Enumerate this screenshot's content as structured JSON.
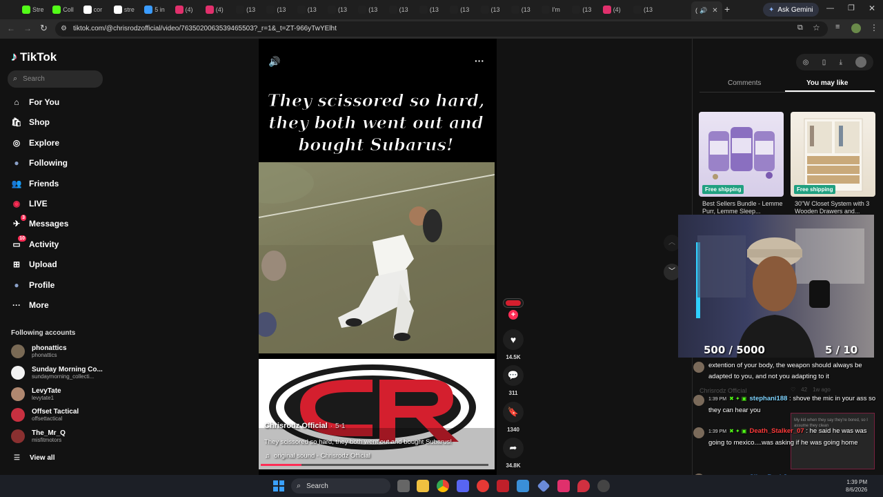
{
  "browser": {
    "tabs": [
      {
        "label": "Stre",
        "color": "#53fc18"
      },
      {
        "label": "Coll",
        "color": "#53fc18"
      },
      {
        "label": "cor",
        "color": "#ffffff"
      },
      {
        "label": "stre",
        "color": "#ffffff"
      },
      {
        "label": "5 in",
        "color": "#3b9cff"
      },
      {
        "label": "(4)",
        "color": "#e1306c"
      },
      {
        "label": "(4)",
        "color": "#e1306c"
      },
      {
        "label": "(13",
        "color": "#222222"
      },
      {
        "label": "(13",
        "color": "#222222"
      },
      {
        "label": "(13",
        "color": "#222222"
      },
      {
        "label": "(13",
        "color": "#222222"
      },
      {
        "label": "(13",
        "color": "#222222"
      },
      {
        "label": "(13",
        "color": "#222222"
      },
      {
        "label": "(13",
        "color": "#222222"
      },
      {
        "label": "(13",
        "color": "#222222"
      },
      {
        "label": "(13",
        "color": "#222222"
      },
      {
        "label": "(13",
        "color": "#222222"
      },
      {
        "label": "I'm",
        "color": "#222222"
      },
      {
        "label": "(13",
        "color": "#222222"
      },
      {
        "label": "(4)",
        "color": "#e1306c"
      },
      {
        "label": "(13",
        "color": "#222222"
      }
    ],
    "active_tab_label": "(",
    "ask_gemini": "Ask Gemini",
    "url": "tiktok.com/@chrisrodzofficial/video/7635020063539465503?_r=1&_t=ZT-966yTwYElht"
  },
  "sidebar": {
    "brand": "TikTok",
    "search_placeholder": "Search",
    "nav": [
      {
        "label": "For You",
        "icon": "home-icon"
      },
      {
        "label": "Shop",
        "icon": "shop-icon"
      },
      {
        "label": "Explore",
        "icon": "compass-icon"
      },
      {
        "label": "Following",
        "icon": "following-icon"
      },
      {
        "label": "Friends",
        "icon": "friends-icon"
      },
      {
        "label": "LIVE",
        "icon": "live-icon"
      },
      {
        "label": "Messages",
        "icon": "messages-icon",
        "badge": "3"
      },
      {
        "label": "Activity",
        "icon": "activity-icon",
        "badge": "10"
      },
      {
        "label": "Upload",
        "icon": "upload-icon"
      },
      {
        "label": "Profile",
        "icon": "profile-icon"
      },
      {
        "label": "More",
        "icon": "more-icon"
      }
    ],
    "following_heading": "Following accounts",
    "accounts": [
      {
        "name": "phonattics",
        "handle": "phonattics",
        "color": "#7a6a55"
      },
      {
        "name": "Sunday Morning Co...",
        "handle": "sundaymorning_collecti...",
        "color": "#f2f2f2"
      },
      {
        "name": "LevyTate",
        "handle": "levytate1",
        "color": "#b08870"
      },
      {
        "name": "Offset Tactical",
        "handle": "offsettactical",
        "color": "#c83040"
      },
      {
        "name": "The_Mr_Q",
        "handle": "misfitmotors",
        "color": "#8a3030"
      }
    ],
    "view_all": "View all"
  },
  "video": {
    "overlay_caption": "They scissored so hard, they both went out and bought Subarus!",
    "author": "Chrisrodz Official",
    "date": "5-1",
    "description": "They scissored so hard, they both went out and bought Subarus!",
    "sound": "original sound - Chrisrodz Official"
  },
  "actions": {
    "likes": "14.5K",
    "comments": "311",
    "saves": "1340",
    "shares": "34.8K"
  },
  "right_panel": {
    "tabs": [
      "Comments",
      "You may like"
    ],
    "active_tab": "You may like",
    "products": [
      {
        "title": "Best Sellers Bundle - Lemme Purr, Lemme Sleep...",
        "badge": "Free shipping"
      },
      {
        "title": "30\"W Closet System with 3 Wooden Drawers and...",
        "badge": "Free shipping"
      }
    ]
  },
  "stream": {
    "goal_left": "500 / 5000",
    "goal_right": "5 / 10",
    "chat": [
      {
        "time": "",
        "user": "",
        "text": "extention of your body, the weapon should always be adapted to you, and not you adapting to it",
        "color": "#7fd4ff"
      },
      {
        "time": "1:39 PM",
        "user": "stephani188",
        "text": " : shove the mic in your ass so they can hear you",
        "color": "#7fd4ff"
      },
      {
        "time": "1:39 PM",
        "user": "Death_Stalker_07",
        "text": " : he said he was was going to mexico....was asking if he was going home",
        "color": "#ff3b3b"
      },
      {
        "time": "1:39 PM",
        "user": "SilverBackJay",
        "text": " :",
        "color": "#4a9cff"
      }
    ],
    "ghost_comment_user": "Chrisrodz Official",
    "ghost_likes": "42",
    "ghost_age": "1w ago",
    "ghost_inset": "My kid when they say they're bored, so I assume they clean"
  },
  "taskbar": {
    "search": "Search",
    "time": "1:39 PM",
    "date": "8/6/2026"
  }
}
